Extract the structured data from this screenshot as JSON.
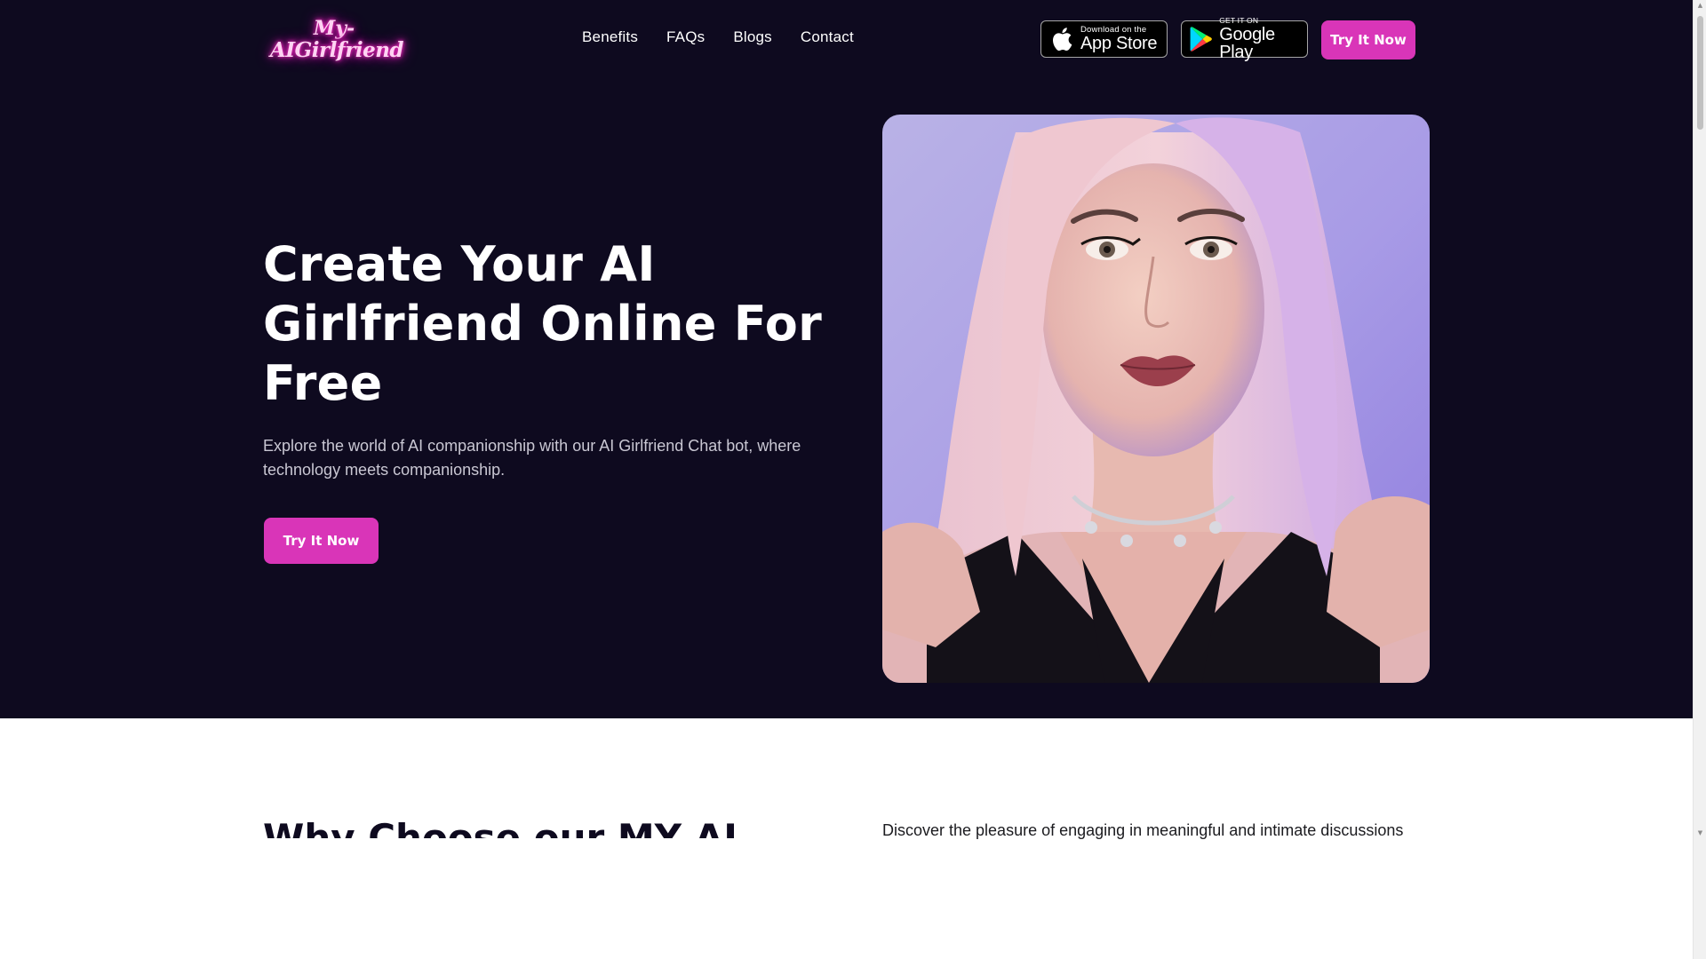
{
  "brand": {
    "logo_line1": "My-",
    "logo_line2": "AIGirlfriend",
    "logo_color": "#ff2fc4"
  },
  "nav": {
    "links": [
      "Benefits",
      "FAQs",
      "Blogs",
      "Contact"
    ]
  },
  "stores": {
    "apple": {
      "small": "Download on the",
      "big": "App Store",
      "icon": "apple-icon"
    },
    "google": {
      "small": "GET IT ON",
      "big": "Google Play",
      "icon": "google-play-icon"
    }
  },
  "header": {
    "cta_label": "Try It Now"
  },
  "hero": {
    "title": "Create Your AI Girlfriend Online For Free",
    "subtitle": "Explore the world of AI companionship with our AI Girlfriend Chat bot, where technology meets companionship.",
    "cta_label": "Try It Now",
    "image": "portrait-photo"
  },
  "section2": {
    "title": "Why Choose our MY AI",
    "description": "Discover the pleasure of engaging in meaningful and intimate discussions"
  },
  "theme": {
    "background": "#0e0a1f",
    "accent": "#d935b8",
    "text": "#ffffff"
  }
}
